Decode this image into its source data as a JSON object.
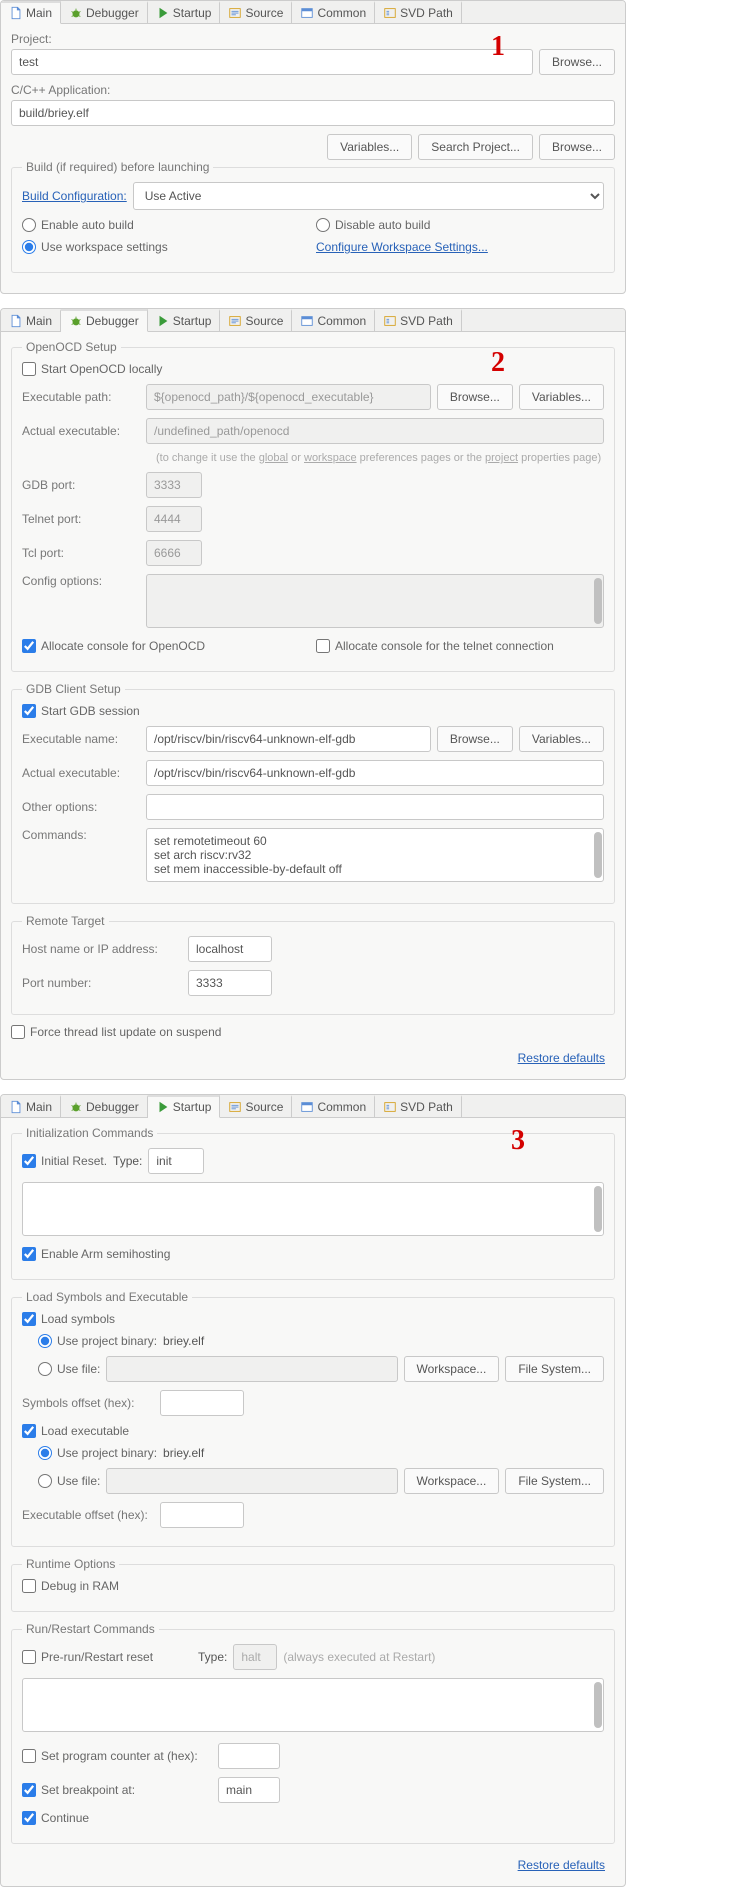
{
  "tabs": {
    "main": "Main",
    "debugger": "Debugger",
    "startup": "Startup",
    "source": "Source",
    "common": "Common",
    "svd": "SVD Path"
  },
  "buttons": {
    "browse": "Browse...",
    "variables": "Variables...",
    "search_project": "Search Project...",
    "workspace": "Workspace...",
    "file_system": "File System..."
  },
  "annot": {
    "one": "1",
    "two": "2",
    "three": "3"
  },
  "panel1": {
    "project_label": "Project:",
    "project_value": "test",
    "app_label": "C/C++ Application:",
    "app_value": "build/briey.elf",
    "build_fieldset": "Build (if required) before launching",
    "build_config_label": "Build Configuration:",
    "build_config_value": "Use Active",
    "enable_auto": "Enable auto build",
    "disable_auto": "Disable auto build",
    "use_workspace": "Use workspace settings",
    "configure_ws": "Configure Workspace Settings..."
  },
  "panel2": {
    "openocd_fieldset": "OpenOCD Setup",
    "start_openocd": "Start OpenOCD locally",
    "exec_path_label": "Executable path:",
    "exec_path_value": "${openocd_path}/${openocd_executable}",
    "actual_exec_label": "Actual executable:",
    "actual_exec_value": "/undefined_path/openocd",
    "change_hint_pre": "(to change it use the ",
    "change_hint_global": "global",
    "change_hint_or": " or ",
    "change_hint_workspace": "workspace",
    "change_hint_mid": " preferences pages or the ",
    "change_hint_project": "project",
    "change_hint_post": " properties page)",
    "gdb_port_label": "GDB port:",
    "gdb_port_value": "3333",
    "telnet_port_label": "Telnet port:",
    "telnet_port_value": "4444",
    "tcl_port_label": "Tcl port:",
    "tcl_port_value": "6666",
    "config_opts_label": "Config options:",
    "alloc_openocd": "Allocate console for OpenOCD",
    "alloc_telnet": "Allocate console for the telnet connection",
    "gdb_client_fieldset": "GDB Client Setup",
    "start_gdb": "Start GDB session",
    "exec_name_label": "Executable name:",
    "exec_name_value": "/opt/riscv/bin/riscv64-unknown-elf-gdb",
    "actual_exec2_label": "Actual executable:",
    "actual_exec2_value": "/opt/riscv/bin/riscv64-unknown-elf-gdb",
    "other_opts_label": "Other options:",
    "commands_label": "Commands:",
    "commands_value": "set remotetimeout 60\nset arch riscv:rv32\nset mem inaccessible-by-default off",
    "remote_fieldset": "Remote Target",
    "host_label": "Host name or IP address:",
    "host_value": "localhost",
    "port_label": "Port number:",
    "port_value": "3333",
    "force_thread": "Force thread list update on suspend",
    "restore": "Restore defaults"
  },
  "panel3": {
    "init_fieldset": "Initialization Commands",
    "initial_reset": "Initial Reset.",
    "type_label": "Type:",
    "type_value": "init",
    "enable_semihosting": "Enable Arm semihosting",
    "load_fieldset": "Load Symbols and Executable",
    "load_symbols": "Load symbols",
    "use_project_binary": "Use project binary:",
    "briey": "briey.elf",
    "use_file": "Use file:",
    "symbols_offset": "Symbols offset (hex):",
    "load_executable": "Load executable",
    "exec_offset": "Executable offset (hex):",
    "runtime_fieldset": "Runtime Options",
    "debug_ram": "Debug in RAM",
    "runrestart_fieldset": "Run/Restart Commands",
    "prerun_reset": "Pre-run/Restart reset",
    "halt_value": "halt",
    "always_exec": "(always executed at Restart)",
    "set_pc": "Set program counter at (hex):",
    "set_bp": "Set breakpoint at:",
    "bp_value": "main",
    "continue": "Continue",
    "restore": "Restore defaults"
  }
}
